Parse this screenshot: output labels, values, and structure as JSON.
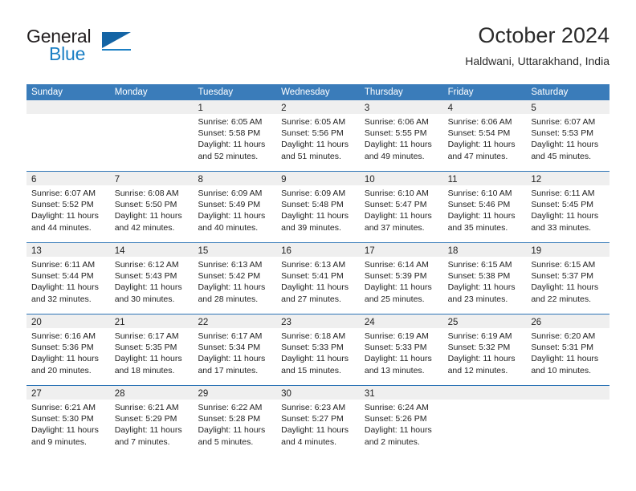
{
  "brand": {
    "word_general": "General",
    "word_blue": "Blue",
    "triangle_color": "#1464a5",
    "blue_color": "#1b7fc4"
  },
  "header": {
    "month_title": "October 2024",
    "location": "Haldwani, Uttarakhand, India"
  },
  "theme": {
    "header_blue": "#3a7cba",
    "row_divider_blue": "#2e75b6",
    "daynum_strip_gray": "#efefef"
  },
  "calendar": {
    "weekday_headers": [
      "Sunday",
      "Monday",
      "Tuesday",
      "Wednesday",
      "Thursday",
      "Friday",
      "Saturday"
    ],
    "weeks": [
      [
        {
          "day": "",
          "lines": []
        },
        {
          "day": "",
          "lines": []
        },
        {
          "day": "1",
          "lines": [
            "Sunrise: 6:05 AM",
            "Sunset: 5:58 PM",
            "Daylight: 11 hours",
            "and 52 minutes."
          ]
        },
        {
          "day": "2",
          "lines": [
            "Sunrise: 6:05 AM",
            "Sunset: 5:56 PM",
            "Daylight: 11 hours",
            "and 51 minutes."
          ]
        },
        {
          "day": "3",
          "lines": [
            "Sunrise: 6:06 AM",
            "Sunset: 5:55 PM",
            "Daylight: 11 hours",
            "and 49 minutes."
          ]
        },
        {
          "day": "4",
          "lines": [
            "Sunrise: 6:06 AM",
            "Sunset: 5:54 PM",
            "Daylight: 11 hours",
            "and 47 minutes."
          ]
        },
        {
          "day": "5",
          "lines": [
            "Sunrise: 6:07 AM",
            "Sunset: 5:53 PM",
            "Daylight: 11 hours",
            "and 45 minutes."
          ]
        }
      ],
      [
        {
          "day": "6",
          "lines": [
            "Sunrise: 6:07 AM",
            "Sunset: 5:52 PM",
            "Daylight: 11 hours",
            "and 44 minutes."
          ]
        },
        {
          "day": "7",
          "lines": [
            "Sunrise: 6:08 AM",
            "Sunset: 5:50 PM",
            "Daylight: 11 hours",
            "and 42 minutes."
          ]
        },
        {
          "day": "8",
          "lines": [
            "Sunrise: 6:09 AM",
            "Sunset: 5:49 PM",
            "Daylight: 11 hours",
            "and 40 minutes."
          ]
        },
        {
          "day": "9",
          "lines": [
            "Sunrise: 6:09 AM",
            "Sunset: 5:48 PM",
            "Daylight: 11 hours",
            "and 39 minutes."
          ]
        },
        {
          "day": "10",
          "lines": [
            "Sunrise: 6:10 AM",
            "Sunset: 5:47 PM",
            "Daylight: 11 hours",
            "and 37 minutes."
          ]
        },
        {
          "day": "11",
          "lines": [
            "Sunrise: 6:10 AM",
            "Sunset: 5:46 PM",
            "Daylight: 11 hours",
            "and 35 minutes."
          ]
        },
        {
          "day": "12",
          "lines": [
            "Sunrise: 6:11 AM",
            "Sunset: 5:45 PM",
            "Daylight: 11 hours",
            "and 33 minutes."
          ]
        }
      ],
      [
        {
          "day": "13",
          "lines": [
            "Sunrise: 6:11 AM",
            "Sunset: 5:44 PM",
            "Daylight: 11 hours",
            "and 32 minutes."
          ]
        },
        {
          "day": "14",
          "lines": [
            "Sunrise: 6:12 AM",
            "Sunset: 5:43 PM",
            "Daylight: 11 hours",
            "and 30 minutes."
          ]
        },
        {
          "day": "15",
          "lines": [
            "Sunrise: 6:13 AM",
            "Sunset: 5:42 PM",
            "Daylight: 11 hours",
            "and 28 minutes."
          ]
        },
        {
          "day": "16",
          "lines": [
            "Sunrise: 6:13 AM",
            "Sunset: 5:41 PM",
            "Daylight: 11 hours",
            "and 27 minutes."
          ]
        },
        {
          "day": "17",
          "lines": [
            "Sunrise: 6:14 AM",
            "Sunset: 5:39 PM",
            "Daylight: 11 hours",
            "and 25 minutes."
          ]
        },
        {
          "day": "18",
          "lines": [
            "Sunrise: 6:15 AM",
            "Sunset: 5:38 PM",
            "Daylight: 11 hours",
            "and 23 minutes."
          ]
        },
        {
          "day": "19",
          "lines": [
            "Sunrise: 6:15 AM",
            "Sunset: 5:37 PM",
            "Daylight: 11 hours",
            "and 22 minutes."
          ]
        }
      ],
      [
        {
          "day": "20",
          "lines": [
            "Sunrise: 6:16 AM",
            "Sunset: 5:36 PM",
            "Daylight: 11 hours",
            "and 20 minutes."
          ]
        },
        {
          "day": "21",
          "lines": [
            "Sunrise: 6:17 AM",
            "Sunset: 5:35 PM",
            "Daylight: 11 hours",
            "and 18 minutes."
          ]
        },
        {
          "day": "22",
          "lines": [
            "Sunrise: 6:17 AM",
            "Sunset: 5:34 PM",
            "Daylight: 11 hours",
            "and 17 minutes."
          ]
        },
        {
          "day": "23",
          "lines": [
            "Sunrise: 6:18 AM",
            "Sunset: 5:33 PM",
            "Daylight: 11 hours",
            "and 15 minutes."
          ]
        },
        {
          "day": "24",
          "lines": [
            "Sunrise: 6:19 AM",
            "Sunset: 5:33 PM",
            "Daylight: 11 hours",
            "and 13 minutes."
          ]
        },
        {
          "day": "25",
          "lines": [
            "Sunrise: 6:19 AM",
            "Sunset: 5:32 PM",
            "Daylight: 11 hours",
            "and 12 minutes."
          ]
        },
        {
          "day": "26",
          "lines": [
            "Sunrise: 6:20 AM",
            "Sunset: 5:31 PM",
            "Daylight: 11 hours",
            "and 10 minutes."
          ]
        }
      ],
      [
        {
          "day": "27",
          "lines": [
            "Sunrise: 6:21 AM",
            "Sunset: 5:30 PM",
            "Daylight: 11 hours",
            "and 9 minutes."
          ]
        },
        {
          "day": "28",
          "lines": [
            "Sunrise: 6:21 AM",
            "Sunset: 5:29 PM",
            "Daylight: 11 hours",
            "and 7 minutes."
          ]
        },
        {
          "day": "29",
          "lines": [
            "Sunrise: 6:22 AM",
            "Sunset: 5:28 PM",
            "Daylight: 11 hours",
            "and 5 minutes."
          ]
        },
        {
          "day": "30",
          "lines": [
            "Sunrise: 6:23 AM",
            "Sunset: 5:27 PM",
            "Daylight: 11 hours",
            "and 4 minutes."
          ]
        },
        {
          "day": "31",
          "lines": [
            "Sunrise: 6:24 AM",
            "Sunset: 5:26 PM",
            "Daylight: 11 hours",
            "and 2 minutes."
          ]
        },
        {
          "day": "",
          "lines": []
        },
        {
          "day": "",
          "lines": []
        }
      ]
    ]
  }
}
